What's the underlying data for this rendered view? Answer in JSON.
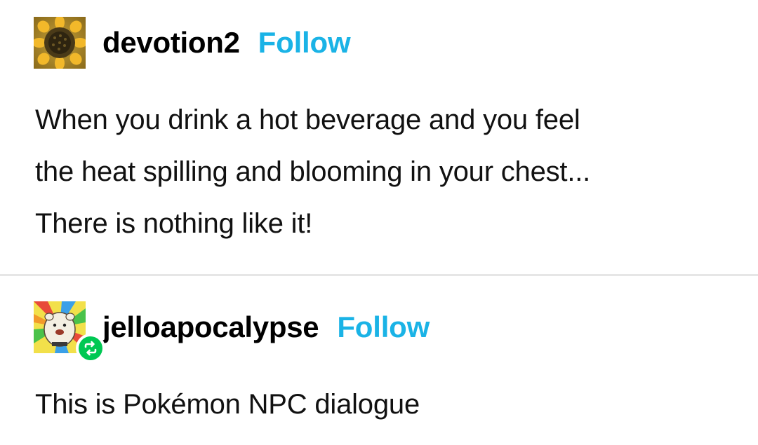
{
  "posts": [
    {
      "username": "devotion2",
      "follow_label": "Follow",
      "avatar_icon": "sunflower-avatar-icon",
      "body_lines": [
        "When you drink a hot beverage and you feel",
        "the heat spilling and blooming in your chest...",
        "There is nothing like it!"
      ]
    },
    {
      "username": "jelloapocalypse",
      "follow_label": "Follow",
      "avatar_icon": "cartoon-character-avatar-icon",
      "badge_icon": "reblog-icon",
      "body_lines": [
        "This is Pokémon NPC dialogue"
      ]
    }
  ],
  "colors": {
    "follow": "#1ab3e6",
    "reblog_badge": "#00c853",
    "divider": "#e6e6e6"
  }
}
